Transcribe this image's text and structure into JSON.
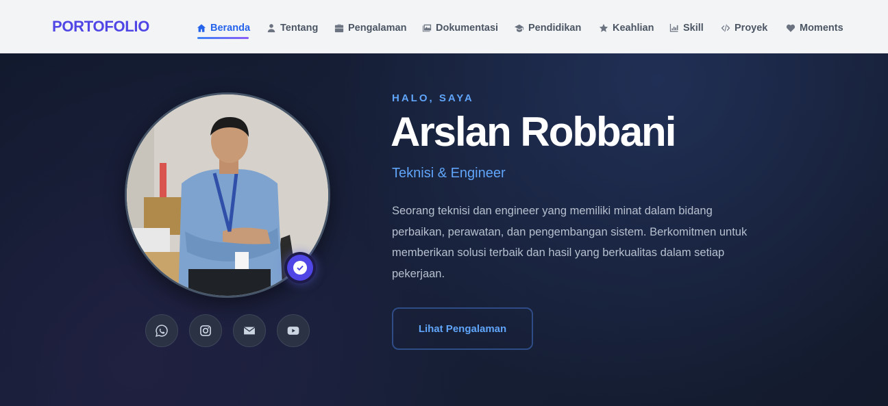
{
  "brand": "PORTOFOLIO",
  "nav": [
    {
      "label": "Beranda",
      "icon": "home-icon",
      "active": true
    },
    {
      "label": "Tentang",
      "icon": "user-icon"
    },
    {
      "label": "Pengalaman",
      "icon": "briefcase-icon"
    },
    {
      "label": "Dokumentasi",
      "icon": "images-icon"
    },
    {
      "label": "Pendidikan",
      "icon": "graduation-cap-icon"
    },
    {
      "label": "Keahlian",
      "icon": "star-icon"
    },
    {
      "label": "Skill",
      "icon": "chart-icon"
    },
    {
      "label": "Proyek",
      "icon": "code-icon"
    },
    {
      "label": "Moments",
      "icon": "heart-icon"
    }
  ],
  "hero": {
    "eyebrow": "HALO, SAYA",
    "name": "Arslan Robbani",
    "role": "Teknisi & Engineer",
    "description": "Seorang teknisi dan engineer yang memiliki minat dalam bidang perbaikan, perawatan, dan pengembangan sistem. Berkomitmen untuk memberikan solusi terbaik dan hasil yang berkualitas dalam setiap pekerjaan.",
    "cta_label": "Lihat Pengalaman"
  },
  "social": [
    "whatsapp-icon",
    "instagram-icon",
    "email-icon",
    "youtube-icon"
  ],
  "colors": {
    "brand": "#4f46e5",
    "accent": "#60a5fa",
    "background": "#121a2e"
  }
}
